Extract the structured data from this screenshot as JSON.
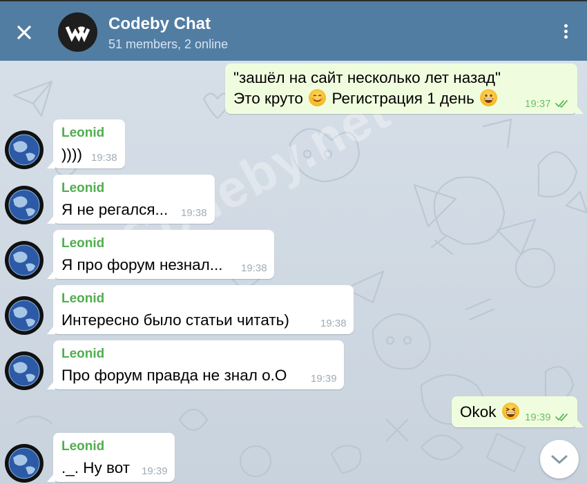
{
  "header": {
    "title": "Codeby Chat",
    "subtitle": "51 members, 2 online"
  },
  "watermark": "Codeby.net",
  "messages": [
    {
      "id": "m0",
      "direction": "out",
      "lines": [
        "\"зашёл на сайт несколько лет назад\"",
        "Это круто"
      ],
      "line2_after_emoji": "Регистрация 1 день",
      "time": "19:37",
      "read": true
    },
    {
      "id": "m1",
      "direction": "in",
      "sender": "Leonid",
      "text": "))))",
      "time": "19:38"
    },
    {
      "id": "m2",
      "direction": "in",
      "sender": "Leonid",
      "text": "Я не регался...",
      "time": "19:38"
    },
    {
      "id": "m3",
      "direction": "in",
      "sender": "Leonid",
      "text": "Я про форум незнал...",
      "time": "19:38"
    },
    {
      "id": "m4",
      "direction": "in",
      "sender": "Leonid",
      "text": "Интересно было статьи читать)",
      "time": "19:38"
    },
    {
      "id": "m5",
      "direction": "in",
      "sender": "Leonid",
      "text": "Про форум правда не знал о.О",
      "time": "19:39"
    },
    {
      "id": "m6",
      "direction": "out",
      "text": "Okok",
      "time": "19:39",
      "read": true
    },
    {
      "id": "m7",
      "direction": "in",
      "sender": "Leonid",
      "text": "._. Ну вот",
      "time": "19:39"
    }
  ],
  "icons": {
    "close": "close-icon",
    "menu": "more-vertical-icon",
    "scroll": "chevron-down-icon",
    "read": "double-check-icon"
  },
  "colors": {
    "header": "#527da3",
    "sender": "#4fae4e",
    "outgoing_bubble": "#effdde",
    "incoming_bubble": "#ffffff",
    "chat_background": "#d1dbe4"
  }
}
